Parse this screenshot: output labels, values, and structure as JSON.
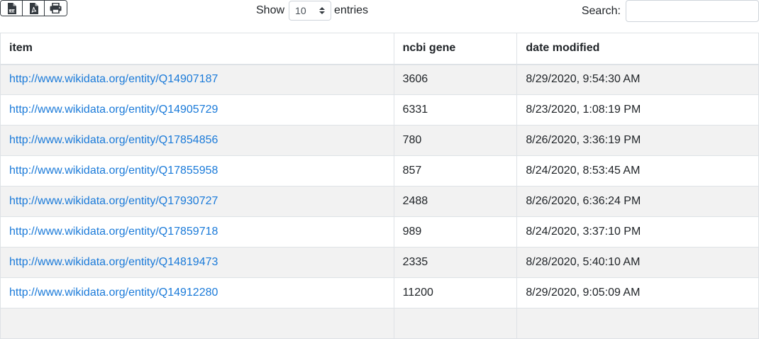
{
  "toolbar": {
    "export_buttons": [
      {
        "icon": "csv-file-icon"
      },
      {
        "icon": "pdf-file-icon"
      },
      {
        "icon": "print-icon"
      }
    ]
  },
  "length": {
    "show_label": "Show",
    "selected": "10",
    "entries_label": "entries"
  },
  "search": {
    "label": "Search:",
    "value": ""
  },
  "table": {
    "headers": [
      "item",
      "ncbi gene",
      "date modified"
    ],
    "rows": [
      {
        "item": "http://www.wikidata.org/entity/Q14907187",
        "gene": "3606",
        "date": "8/29/2020, 9:54:30 AM"
      },
      {
        "item": "http://www.wikidata.org/entity/Q14905729",
        "gene": "6331",
        "date": "8/23/2020, 1:08:19 PM"
      },
      {
        "item": "http://www.wikidata.org/entity/Q17854856",
        "gene": "780",
        "date": "8/26/2020, 3:36:19 PM"
      },
      {
        "item": "http://www.wikidata.org/entity/Q17855958",
        "gene": "857",
        "date": "8/24/2020, 8:53:45 AM"
      },
      {
        "item": "http://www.wikidata.org/entity/Q17930727",
        "gene": "2488",
        "date": "8/26/2020, 6:36:24 PM"
      },
      {
        "item": "http://www.wikidata.org/entity/Q17859718",
        "gene": "989",
        "date": "8/24/2020, 3:37:10 PM"
      },
      {
        "item": "http://www.wikidata.org/entity/Q14819473",
        "gene": "2335",
        "date": "8/28/2020, 5:40:10 AM"
      },
      {
        "item": "http://www.wikidata.org/entity/Q14912280",
        "gene": "11200",
        "date": "8/29/2020, 9:05:09 AM"
      },
      {
        "item": "",
        "gene": "",
        "date": ""
      }
    ]
  },
  "colors": {
    "link": "#1a7ad9",
    "stripe": "#f2f2f2",
    "border": "#dee2e6"
  }
}
